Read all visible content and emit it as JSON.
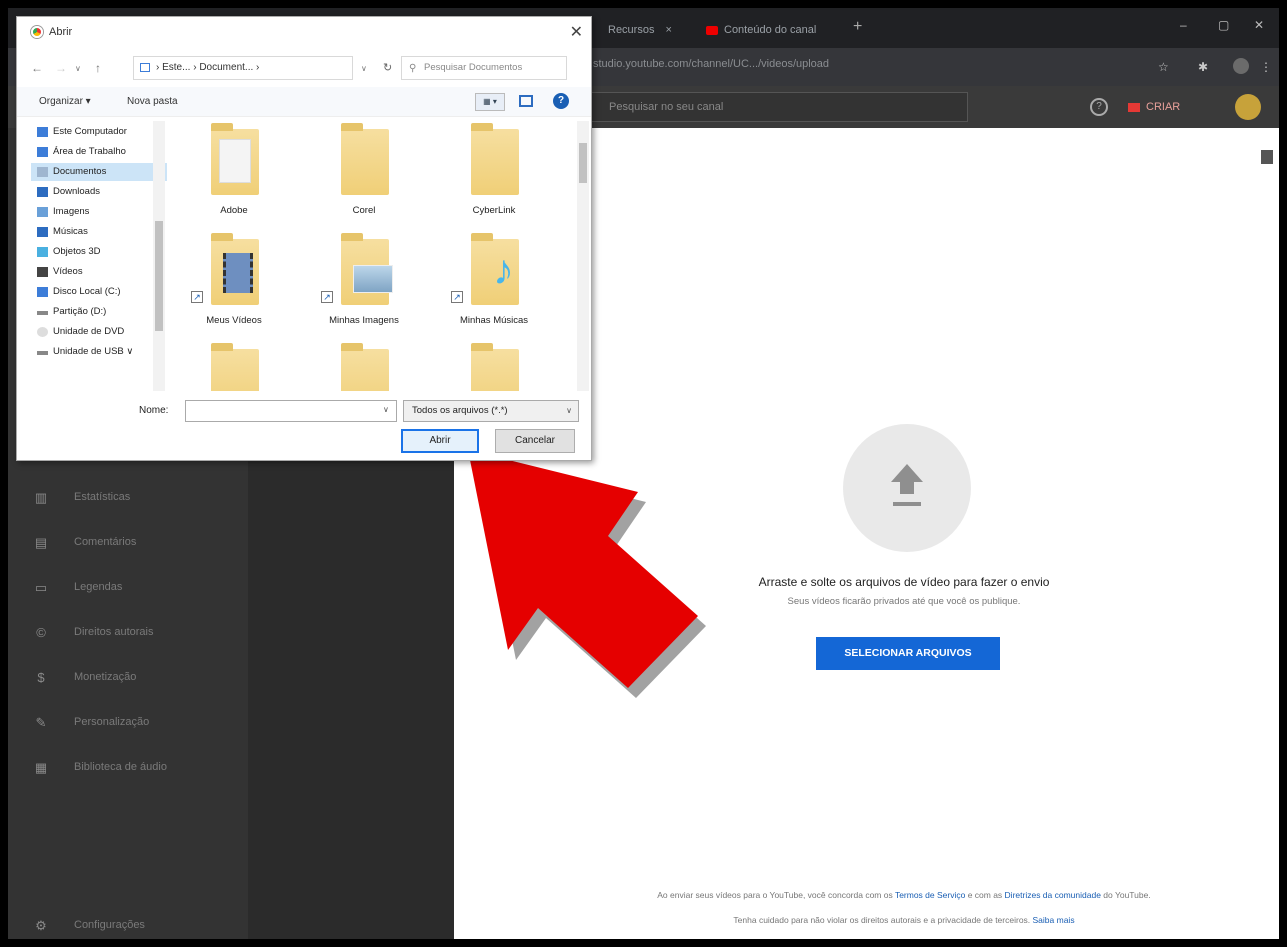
{
  "browser": {
    "tabs": [
      {
        "label": "Recursos"
      },
      {
        "label": "Conteúdo do canal"
      }
    ],
    "new_tab": "+",
    "url": "studio.youtube.com/channel/UC.../videos/upload",
    "window_controls": {
      "minimize": "–",
      "maximize": "▢",
      "close": "✕"
    }
  },
  "studio_header": {
    "search_placeholder": "Pesquisar no seu canal",
    "create_label": "CRIAR",
    "help": "?"
  },
  "sidebar": {
    "items": [
      {
        "label": "Estatísticas",
        "icon": "analytics-icon",
        "glyph": "▥"
      },
      {
        "label": "Comentários",
        "icon": "comments-icon",
        "glyph": "▤"
      },
      {
        "label": "Legendas",
        "icon": "subtitles-icon",
        "glyph": "▭"
      },
      {
        "label": "Direitos autorais",
        "icon": "copyright-icon",
        "glyph": "©"
      },
      {
        "label": "Monetização",
        "icon": "monetization-icon",
        "glyph": "$"
      },
      {
        "label": "Personalização",
        "icon": "customization-icon",
        "glyph": "✎"
      },
      {
        "label": "Biblioteca de áudio",
        "icon": "audio-library-icon",
        "glyph": "▦"
      }
    ],
    "settings": {
      "label": "Configurações",
      "icon": "settings-icon",
      "glyph": "⚙"
    }
  },
  "upload": {
    "drag_text": "Arraste e solte os arquivos de vídeo para fazer o envio",
    "private_text": "Seus vídeos ficarão privados até que você os publique.",
    "select_button": "SELECIONAR ARQUIVOS",
    "terms_prefix": "Ao enviar seus vídeos para o YouTube, você concorda com os ",
    "terms_link": "Termos de Serviço",
    "terms_mid": " e com as ",
    "guidelines_link": "Diretrizes da comunidade",
    "terms_suffix": " do YouTube.",
    "rights_text": "Tenha cuidado para não violar os direitos autorais e a privacidade de terceiros. ",
    "learn_more": "Saiba mais"
  },
  "dialog": {
    "title": "Abrir",
    "close": "✕",
    "path": "› Este... › Document... ›",
    "search_placeholder": "Pesquisar Documentos",
    "organize": "Organizar ▾",
    "new_folder": "Nova pasta",
    "help": "?",
    "nav": [
      {
        "label": "Este Computador",
        "icon": "computer-icon",
        "color": "#3d7dd8"
      },
      {
        "label": "Área de Trabalho",
        "icon": "desktop-icon",
        "color": "#3d7dd8"
      },
      {
        "label": "Documentos",
        "icon": "documents-icon",
        "color": "#9fb6d0",
        "selected": true
      },
      {
        "label": "Downloads",
        "icon": "downloads-icon",
        "color": "#2d6cc0"
      },
      {
        "label": "Imagens",
        "icon": "images-icon",
        "color": "#6aa0d8"
      },
      {
        "label": "Músicas",
        "icon": "music-icon",
        "color": "#2d6cc0"
      },
      {
        "label": "Objetos 3D",
        "icon": "3d-objects-icon",
        "color": "#4ab0e0"
      },
      {
        "label": "Vídeos",
        "icon": "videos-icon",
        "color": "#444"
      },
      {
        "label": "Disco Local (C:)",
        "icon": "disk-icon",
        "color": "#3d7dd8"
      },
      {
        "label": "Partição (D:)",
        "icon": "disk-icon",
        "color": "#888"
      },
      {
        "label": "Unidade de DVD",
        "icon": "dvd-icon",
        "color": "#bbb"
      },
      {
        "label": "Unidade de USB ∨",
        "icon": "usb-icon",
        "color": "#888"
      }
    ],
    "files": [
      {
        "label": "Adobe",
        "type": "folder-docs"
      },
      {
        "label": "Corel",
        "type": "folder"
      },
      {
        "label": "CyberLink",
        "type": "folder"
      },
      {
        "label": "Meus Vídeos",
        "type": "folder-videos",
        "shortcut": true
      },
      {
        "label": "Minhas Imagens",
        "type": "folder-images",
        "shortcut": true
      },
      {
        "label": "Minhas Músicas",
        "type": "folder-music",
        "shortcut": true
      },
      {
        "label": "",
        "type": "folder"
      },
      {
        "label": "",
        "type": "folder"
      },
      {
        "label": "",
        "type": "folder"
      }
    ],
    "name_label": "Nome:",
    "name_value": "",
    "filter": "Todos os arquivos (*.*)",
    "open_button": "Abrir",
    "cancel_button": "Cancelar"
  },
  "colors": {
    "accent_blue": "#1467d6",
    "arrow_red": "#e50000",
    "sidebar_dark": "#333333"
  }
}
